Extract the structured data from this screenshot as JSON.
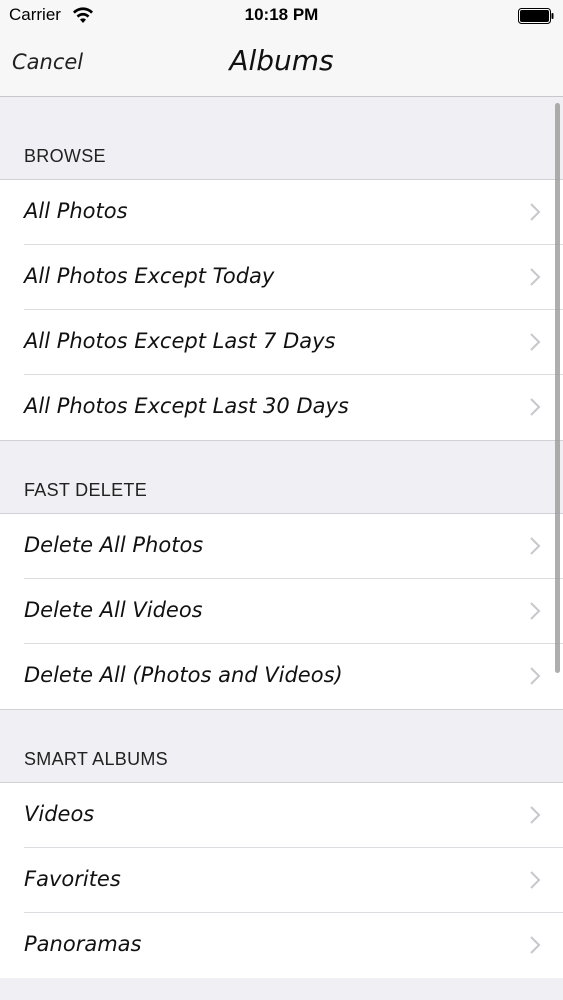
{
  "status_bar": {
    "carrier": "Carrier",
    "time": "10:18 PM"
  },
  "nav": {
    "cancel_label": "Cancel",
    "title": "Albums"
  },
  "sections": [
    {
      "header": "BROWSE",
      "items": [
        "All Photos",
        "All Photos Except Today",
        "All Photos Except Last 7 Days",
        "All Photos Except Last 30 Days"
      ]
    },
    {
      "header": "FAST DELETE",
      "items": [
        "Delete All Photos",
        "Delete All Videos",
        "Delete All (Photos and Videos)"
      ]
    },
    {
      "header": "SMART ALBUMS",
      "items": [
        "Videos",
        "Favorites",
        "Panoramas"
      ]
    }
  ],
  "icons": {
    "wifi": "wifi-icon",
    "battery": "battery-icon",
    "chevron": "chevron-right-icon"
  }
}
